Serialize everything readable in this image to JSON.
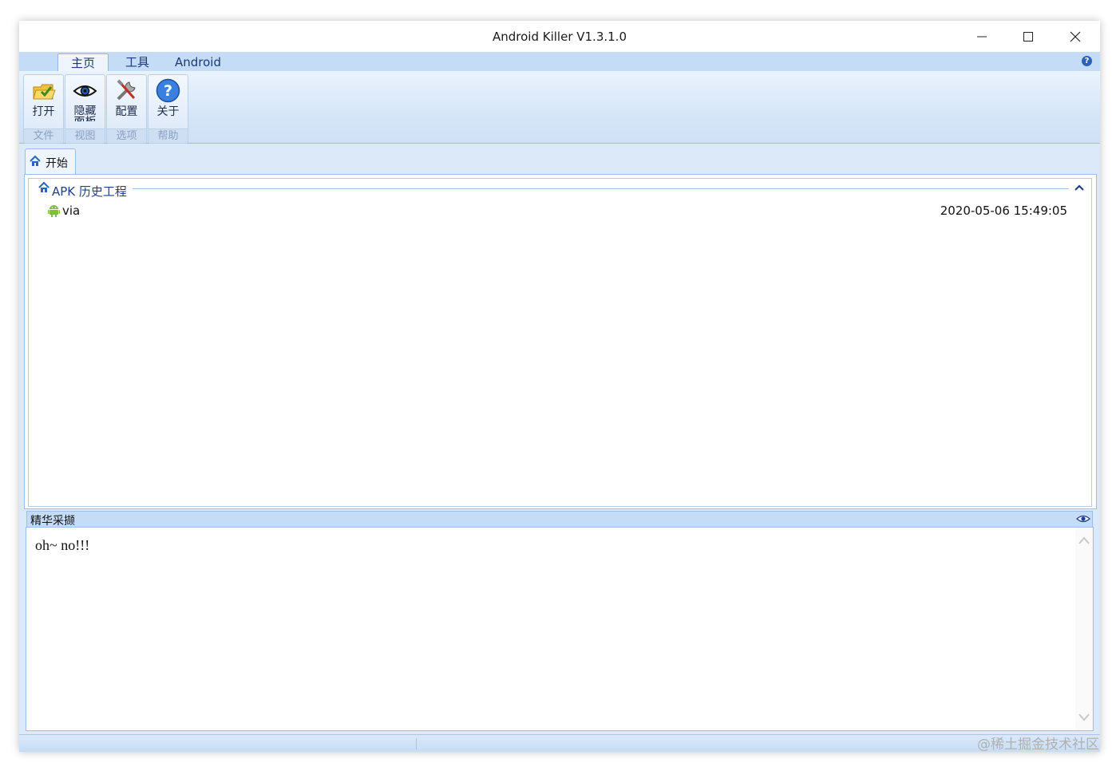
{
  "window": {
    "title": "Android Killer V1.3.1.0",
    "minimize_icon": "minimize-icon",
    "maximize_icon": "maximize-icon",
    "close_icon": "close-icon"
  },
  "ribbon_tabs": [
    {
      "label": "主页",
      "active": true
    },
    {
      "label": "工具",
      "active": false
    },
    {
      "label": "Android",
      "active": false
    }
  ],
  "ribbon_groups": [
    {
      "button": "打开",
      "group": "文件",
      "icon": "folder-open-icon"
    },
    {
      "button": "隐藏面板",
      "group": "视图",
      "icon": "eye-icon"
    },
    {
      "button": "配置",
      "group": "选项",
      "icon": "tools-icon"
    },
    {
      "button": "关于",
      "group": "帮助",
      "icon": "help-icon"
    }
  ],
  "doc_tab": {
    "label": "开始",
    "icon": "home-icon"
  },
  "apk_history": {
    "title": "APK 历史工程",
    "items": [
      {
        "name": "via",
        "date": "2020-05-06 15:49:05",
        "icon": "android-icon"
      }
    ]
  },
  "notes": {
    "title": "精华采撷",
    "text": "oh~ no!!!"
  },
  "watermark": "@稀土掘金技术社区",
  "colors": {
    "ribbon_bg": "#c5dcf6",
    "border": "#9dbde6",
    "accent_text": "#1f3f86"
  }
}
